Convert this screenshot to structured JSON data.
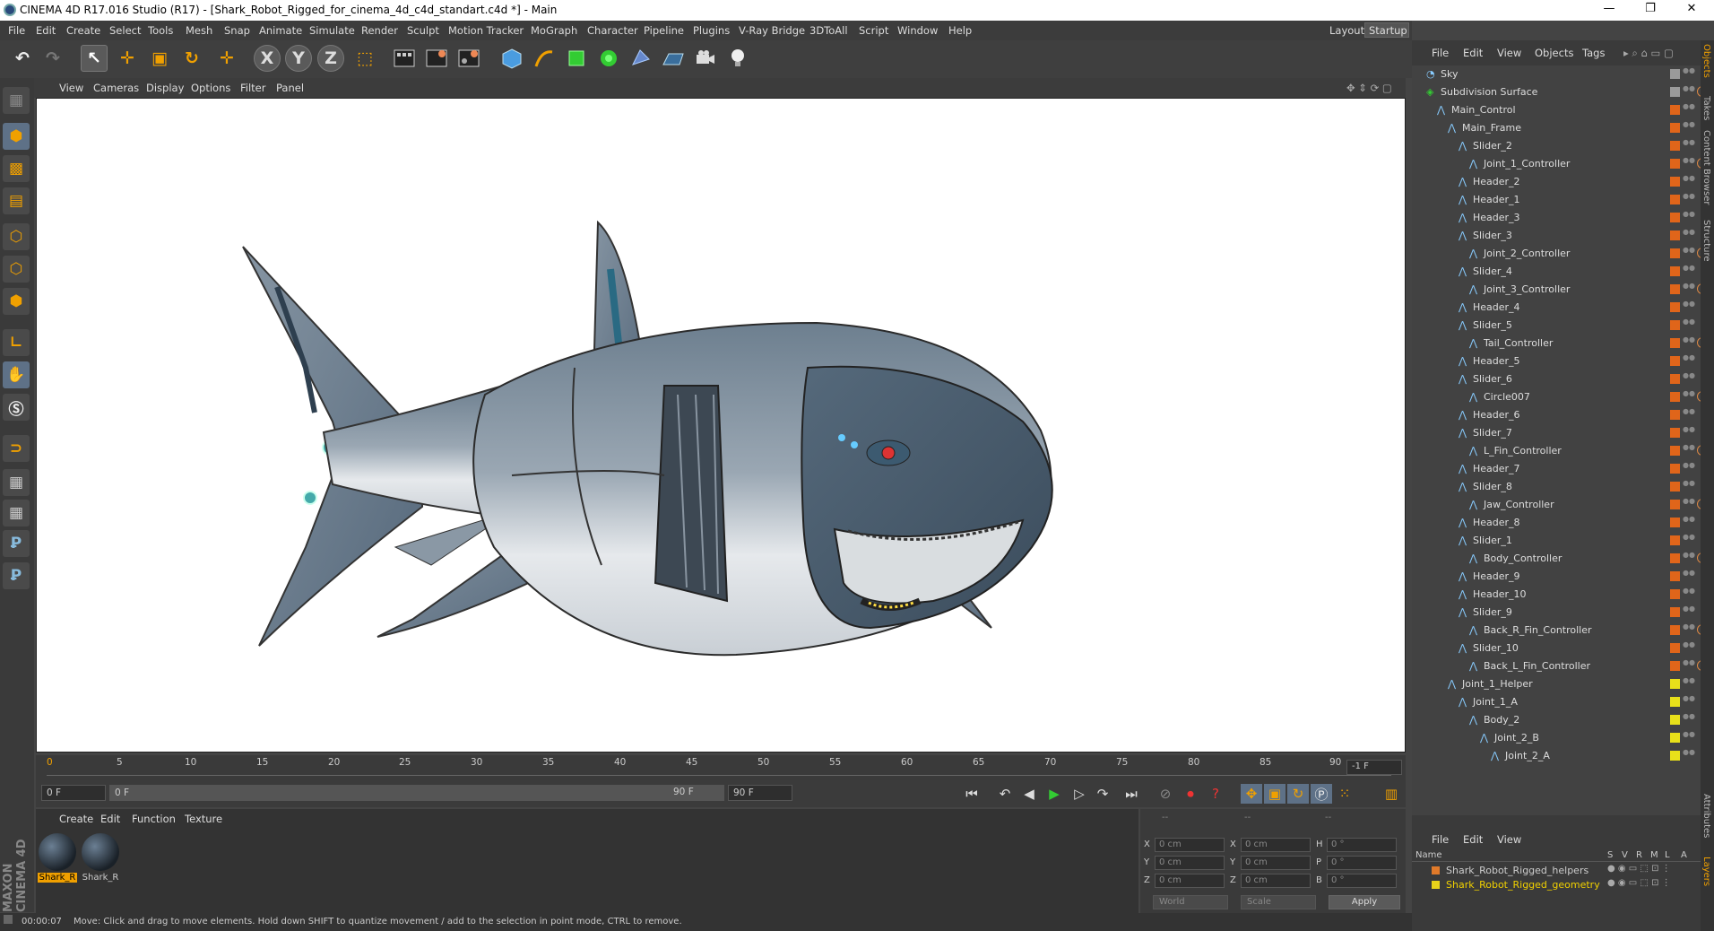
{
  "window": {
    "title": "CINEMA 4D R17.016 Studio (R17) - [Shark_Robot_Rigged_for_cinema_4d_c4d_standart.c4d *] - Main",
    "minimize": "—",
    "restore": "❐",
    "close": "✕"
  },
  "menu": [
    "File",
    "Edit",
    "Create",
    "Select",
    "Tools",
    "Mesh",
    "Snap",
    "Animate",
    "Simulate",
    "Render",
    "Sculpt",
    "Motion Tracker",
    "MoGraph",
    "Character",
    "Pipeline",
    "Plugins",
    "V-Ray Bridge",
    "3DToAll",
    "Script",
    "Window",
    "Help"
  ],
  "layout": {
    "label": "Layout:",
    "value": "Startup (User)"
  },
  "toolbar": {
    "undo": "↶",
    "redo": "↷",
    "select": "↖",
    "move": "✛",
    "scale": "▣",
    "rotate": "↻",
    "last": "✛",
    "x": "X",
    "y": "Y",
    "z": "Z",
    "coord": "⬚"
  },
  "viewport_menu": [
    "View",
    "Cameras",
    "Display",
    "Options",
    "Filter",
    "Panel"
  ],
  "timeline": {
    "ticks": [
      "0",
      "5",
      "10",
      "15",
      "20",
      "25",
      "30",
      "35",
      "40",
      "45",
      "50",
      "55",
      "60",
      "65",
      "70",
      "75",
      "80",
      "85",
      "90"
    ],
    "end_label": "-1 F"
  },
  "playback": {
    "current": "0 F",
    "range_start": "0 F",
    "range_end": "90 F",
    "max": "90 F"
  },
  "material_menu": [
    "Create",
    "Edit",
    "Function",
    "Texture"
  ],
  "materials": [
    {
      "label": "Shark_R",
      "selected": true
    },
    {
      "label": "Shark_R",
      "selected": false
    }
  ],
  "coords": {
    "headers": [
      "--",
      "--",
      "--"
    ],
    "rows": [
      {
        "a": "X",
        "av": "0 cm",
        "b": "X",
        "bv": "0 cm",
        "c": "H",
        "cv": "0 °"
      },
      {
        "a": "Y",
        "av": "0 cm",
        "b": "Y",
        "bv": "0 cm",
        "c": "P",
        "cv": "0 °"
      },
      {
        "a": "Z",
        "av": "0 cm",
        "b": "Z",
        "bv": "0 cm",
        "c": "B",
        "cv": "0 °"
      }
    ],
    "world": "World",
    "scale": "Scale",
    "apply": "Apply"
  },
  "status": {
    "time": "00:00:07",
    "message": "Move: Click and drag to move elements. Hold down SHIFT to quantize movement / add to the selection in point mode, CTRL to remove."
  },
  "object_menu": [
    "File",
    "Edit",
    "View",
    "Objects",
    "Tags"
  ],
  "objects": [
    {
      "name": "Sky",
      "indent": 0,
      "tag": "grey"
    },
    {
      "name": "Subdivision Surface",
      "indent": 0,
      "tag": "grey",
      "x": true
    },
    {
      "name": "Main_Control",
      "indent": 1,
      "tag": "orange"
    },
    {
      "name": "Main_Frame",
      "indent": 2,
      "tag": "orange"
    },
    {
      "name": "Slider_2",
      "indent": 3,
      "tag": "orange"
    },
    {
      "name": "Joint_1_Controller",
      "indent": 4,
      "tag": "orange",
      "x": true
    },
    {
      "name": "Header_2",
      "indent": 3,
      "tag": "orange"
    },
    {
      "name": "Header_1",
      "indent": 3,
      "tag": "orange"
    },
    {
      "name": "Header_3",
      "indent": 3,
      "tag": "orange"
    },
    {
      "name": "Slider_3",
      "indent": 3,
      "tag": "orange"
    },
    {
      "name": "Joint_2_Controller",
      "indent": 4,
      "tag": "orange",
      "x": true
    },
    {
      "name": "Slider_4",
      "indent": 3,
      "tag": "orange"
    },
    {
      "name": "Joint_3_Controller",
      "indent": 4,
      "tag": "orange",
      "x": true
    },
    {
      "name": "Header_4",
      "indent": 3,
      "tag": "orange"
    },
    {
      "name": "Slider_5",
      "indent": 3,
      "tag": "orange"
    },
    {
      "name": "Tail_Controller",
      "indent": 4,
      "tag": "orange",
      "x": true
    },
    {
      "name": "Header_5",
      "indent": 3,
      "tag": "orange"
    },
    {
      "name": "Slider_6",
      "indent": 3,
      "tag": "orange"
    },
    {
      "name": "Circle007",
      "indent": 4,
      "tag": "orange",
      "x": true
    },
    {
      "name": "Header_6",
      "indent": 3,
      "tag": "orange"
    },
    {
      "name": "Slider_7",
      "indent": 3,
      "tag": "orange"
    },
    {
      "name": "L_Fin_Controller",
      "indent": 4,
      "tag": "orange",
      "x": true
    },
    {
      "name": "Header_7",
      "indent": 3,
      "tag": "orange"
    },
    {
      "name": "Slider_8",
      "indent": 3,
      "tag": "orange"
    },
    {
      "name": "Jaw_Controller",
      "indent": 4,
      "tag": "orange",
      "x": true
    },
    {
      "name": "Header_8",
      "indent": 3,
      "tag": "orange"
    },
    {
      "name": "Slider_1",
      "indent": 3,
      "tag": "orange"
    },
    {
      "name": "Body_Controller",
      "indent": 4,
      "tag": "orange",
      "x": true
    },
    {
      "name": "Header_9",
      "indent": 3,
      "tag": "orange"
    },
    {
      "name": "Header_10",
      "indent": 3,
      "tag": "orange"
    },
    {
      "name": "Slider_9",
      "indent": 3,
      "tag": "orange"
    },
    {
      "name": "Back_R_Fin_Controller",
      "indent": 4,
      "tag": "orange",
      "x": true
    },
    {
      "name": "Slider_10",
      "indent": 3,
      "tag": "orange"
    },
    {
      "name": "Back_L_Fin_Controller",
      "indent": 4,
      "tag": "orange",
      "x": true
    },
    {
      "name": "Joint_1_Helper",
      "indent": 2,
      "tag": "yellow"
    },
    {
      "name": "Joint_1_A",
      "indent": 3,
      "tag": "yellow"
    },
    {
      "name": "Body_2",
      "indent": 4,
      "tag": "yellow"
    },
    {
      "name": "Joint_2_B",
      "indent": 5,
      "tag": "yellow"
    },
    {
      "name": "Joint_2_A",
      "indent": 6,
      "tag": "yellow"
    }
  ],
  "side_tabs": [
    "Objects",
    "Takes",
    "Content Browser",
    "Structure",
    "Attributes",
    "Layers"
  ],
  "layer_menu": [
    "File",
    "Edit",
    "View"
  ],
  "layer_header": {
    "name": "Name",
    "cols": [
      "S",
      "V",
      "R",
      "M",
      "L",
      "A"
    ]
  },
  "layers": [
    {
      "name": "Shark_Robot_Rigged_helpers",
      "color": "#e07a2a",
      "text": "#ddd"
    },
    {
      "name": "Shark_Robot_Rigged_geometry",
      "color": "#e8d21a",
      "text": "#f0d000"
    }
  ],
  "colors": {
    "orange": "#e0651a",
    "yellow": "#e8e01a",
    "grey": "#9a9a9a",
    "accent": "#f0a000"
  }
}
